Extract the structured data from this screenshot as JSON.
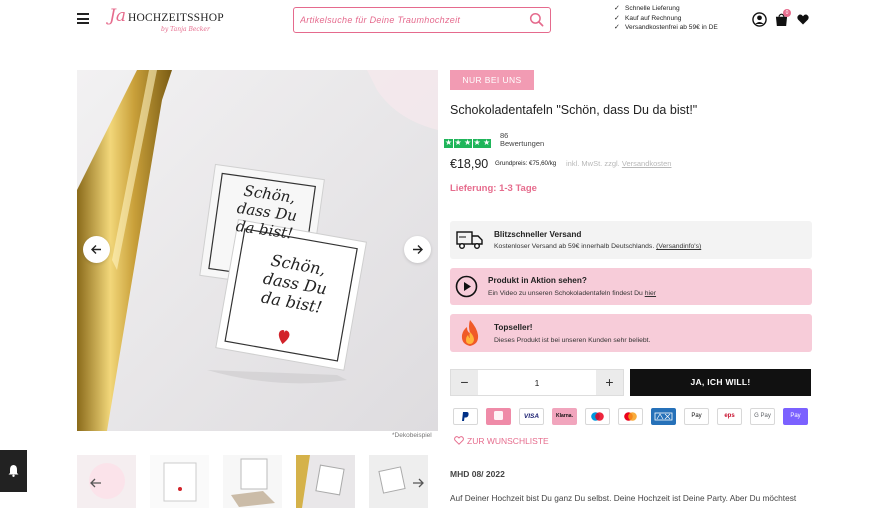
{
  "header": {
    "menu_icon": "hamburger-icon",
    "logo": {
      "ja": "Ja",
      "main": "HOCHZEITSSHOP",
      "sub": "by Tanja Becker"
    },
    "search": {
      "placeholder": "Artikelsuche für Deine Traumhochzeit",
      "icon": "search-icon"
    },
    "usps": [
      "Schnelle Lieferung",
      "Kauf auf Rechnung",
      "Versandkostenfrei ab 59€ in DE"
    ],
    "cart_count": "0",
    "icons": [
      "user-icon",
      "cart-icon",
      "heart-icon"
    ]
  },
  "gallery": {
    "photo_text_1": [
      "Schön,",
      "dass Du",
      "da bist!"
    ],
    "photo_text_2": [
      "Schön,",
      "dass Du",
      "da bist!"
    ],
    "caption": "*Dekobeispiel"
  },
  "product": {
    "badge": "NUR BEI UNS",
    "title": "Schokoladentafeln \"Schön, dass Du da bist!\"",
    "rating_stars": 5,
    "review_count": "86",
    "review_label": "Bewertungen",
    "price": "€18,90",
    "base_price": "Grundpreis: €75,60/kg",
    "tax_note": "inkl. MwSt. zzgl.",
    "shipping_link": "Versandkosten",
    "delivery": "Lieferung: 1-3 Tage"
  },
  "infoboxes": {
    "shipping": {
      "title": "Blitzschneller Versand",
      "text": "Kostenloser Versand ab 59€ innerhalb Deutschlands.",
      "link": "(Versandinfo's)"
    },
    "video": {
      "title": "Produkt in Aktion sehen?",
      "text": "Ein Video zu unseren Schokoladentafeln findest Du",
      "link": "hier"
    },
    "topseller": {
      "title": "Topseller!",
      "text": "Dieses Produkt ist bei unseren Kunden sehr beliebt."
    }
  },
  "purchase": {
    "minus": "−",
    "plus": "+",
    "quantity": "1",
    "buy_label": "JA, ICH WILL!"
  },
  "payments": [
    "PayPal",
    "Klarna Sofort",
    "VISA",
    "Klarna",
    "Maestro",
    "Mastercard",
    "AMEX",
    "Apple Pay",
    "EPS",
    "G Pay",
    "Apple Pay"
  ],
  "wishlist_label": "ZUR WUNSCHLISTE",
  "mhd": "MHD 08/ 2022",
  "description": "Auf Deiner Hochzeit bist Du ganz Du selbst. Deine Hochzeit ist Deine Party. Aber Du möchtest auch Deine Gäste glücklich machen. Daher ist ein Gastgeschenk für Deine"
}
